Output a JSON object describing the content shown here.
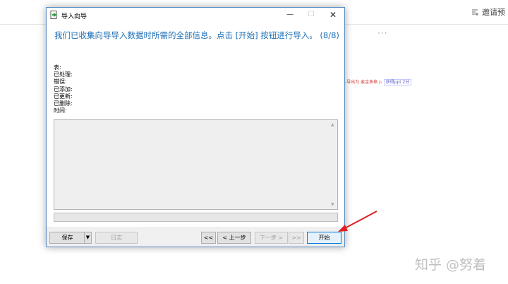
{
  "background": {
    "invite_text": "邀请预",
    "more_text": "···",
    "snippet_text": "/-导出为 麦金表格 ▷",
    "snippet_chip": "获得ppt 2分",
    "watermark": "知乎 @努着"
  },
  "dialog": {
    "title": "导入向导",
    "minimize_glyph": "—",
    "maximize_glyph": "☐",
    "close_glyph": "✕",
    "heading": "我们已收集向导导入数据时所需的全部信息。点击 [开始] 按钮进行导入。 (8/8)",
    "stats": {
      "table": "表:",
      "processed": "已处理:",
      "errors": "错误:",
      "added": "已添加:",
      "updated": "已更新:",
      "deleted": "已删除:",
      "time": "时间:"
    },
    "scroll_up_glyph": "▲",
    "scroll_down_glyph": "▼",
    "buttons": {
      "save": "保存",
      "save_dropdown": "▼",
      "log": "日志",
      "first": "<<",
      "prev": "< 上一步",
      "next": "下一步 >",
      "last": ">>",
      "start": "开始"
    }
  },
  "colors": {
    "heading": "#1e6fb5",
    "arrow": "#e02020",
    "window_border": "#5a8fc4"
  }
}
